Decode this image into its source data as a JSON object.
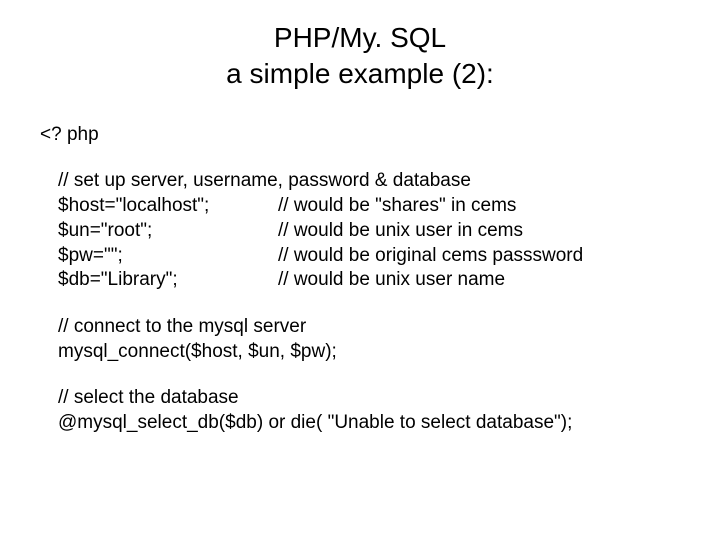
{
  "title_line1": "PHP/My. SQL",
  "title_line2": "a simple example (2):",
  "open_tag": "<? php",
  "section1": {
    "comment": "// set up server, username, password & database",
    "rows": [
      {
        "left": "$host=\"localhost\";",
        "right": "// would be \"shares\" in cems"
      },
      {
        "left": "$un=\"root\";",
        "right": "// would be unix user in cems"
      },
      {
        "left": "$pw=\"\";",
        "right": "// would be original cems passsword"
      },
      {
        "left": "$db=\"Library\";",
        "right": "// would be unix user name"
      }
    ]
  },
  "section2": {
    "comment": "// connect to the mysql server",
    "line": "mysql_connect($host, $un, $pw);"
  },
  "section3": {
    "comment": "// select the database",
    "line": "@mysql_select_db($db) or die( \"Unable to select database\");"
  }
}
